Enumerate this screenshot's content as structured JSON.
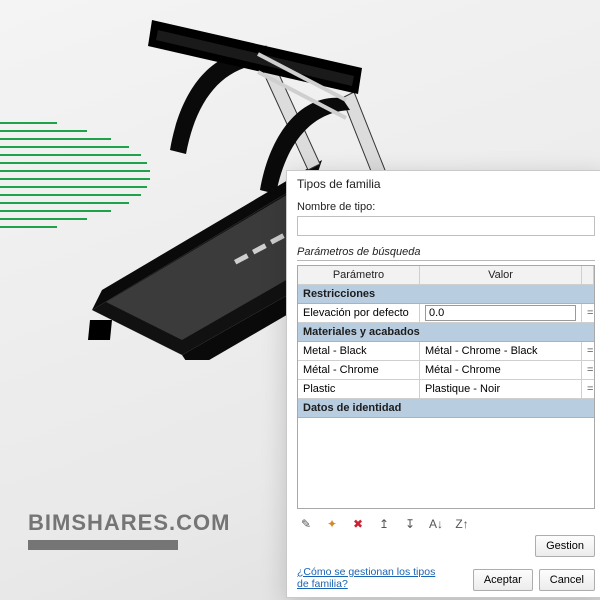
{
  "watermark": "BIMSHARES.COM",
  "dialog": {
    "title": "Tipos de familia",
    "type_name_label": "Nombre de tipo:",
    "type_name_value": "",
    "search_section": "Parámetros de búsqueda",
    "headers": {
      "param": "Parámetro",
      "value": "Valor"
    },
    "groups": [
      {
        "name": "Restricciones",
        "rows": [
          {
            "param": "Elevación por defecto",
            "value": "0.0",
            "editable": true
          }
        ]
      },
      {
        "name": "Materiales y acabados",
        "rows": [
          {
            "param": "Metal - Black",
            "value": "Métal - Chrome - Black"
          },
          {
            "param": "Métal - Chrome",
            "value": "Métal - Chrome"
          },
          {
            "param": "Plastic",
            "value": "Plastique - Noir"
          }
        ]
      },
      {
        "name": "Datos de identidad",
        "rows": []
      }
    ],
    "manage_button": "Gestion",
    "help_link": "¿Cómo se gestionan los tipos de familia?",
    "ok": "Aceptar",
    "cancel": "Cancel"
  }
}
